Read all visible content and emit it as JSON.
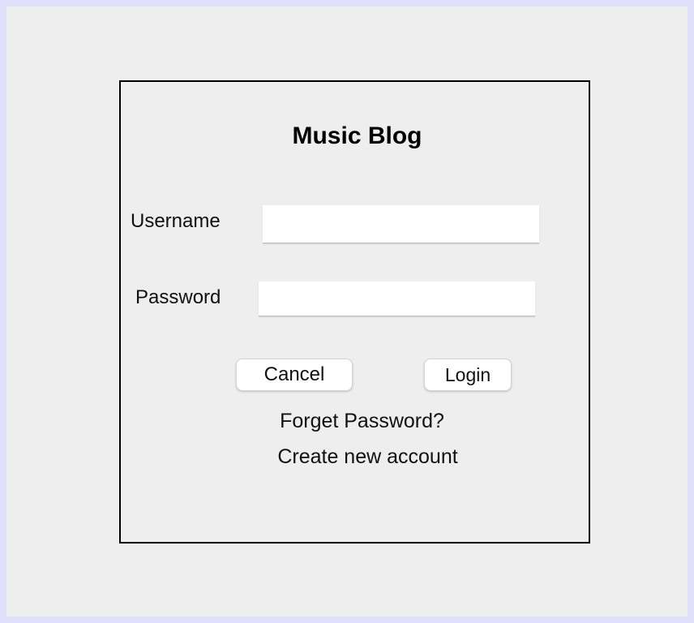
{
  "app": {
    "title": "Music Blog"
  },
  "form": {
    "username_label": "Username",
    "username_value": "",
    "password_label": "Password",
    "password_value": ""
  },
  "buttons": {
    "cancel_label": "Cancel",
    "login_label": "Login"
  },
  "links": {
    "forget_password": "Forget Password?",
    "create_account": "Create new account"
  },
  "colors": {
    "outer_border": "#e0e0fa",
    "window_background": "#eeeeee",
    "panel_border": "#000000",
    "input_background": "#ffffff"
  }
}
